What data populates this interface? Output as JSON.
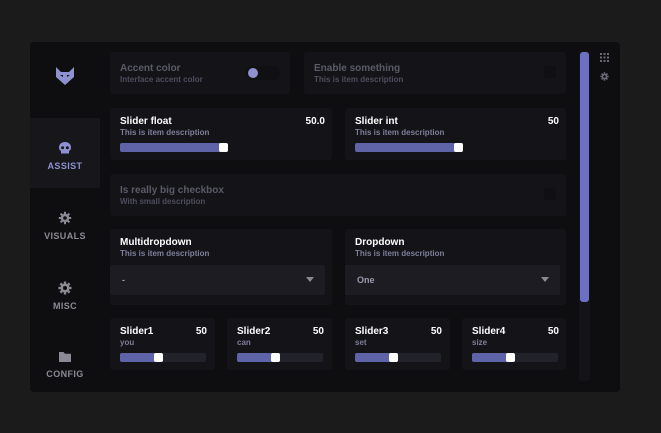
{
  "sidebar": {
    "items": [
      {
        "label": "ASSIST",
        "icon": "skull-icon",
        "active": true
      },
      {
        "label": "VISUALS",
        "icon": "gear-icon",
        "active": false
      },
      {
        "label": "MISC",
        "icon": "gear-icon",
        "active": false
      },
      {
        "label": "CONFIG",
        "icon": "folder-icon",
        "active": false
      }
    ]
  },
  "accent": {
    "title": "Accent color",
    "desc": "Interface accent color",
    "toggle_on": true,
    "color": "#8e90d0"
  },
  "enable": {
    "title": "Enable something",
    "desc": "This is item description"
  },
  "slider_float": {
    "title": "Slider float",
    "desc": "This is item description",
    "value": "50.0",
    "fraction": 1.0
  },
  "slider_int": {
    "title": "Slider int",
    "desc": "This is item description",
    "value": "50",
    "fraction": 1.0
  },
  "big_checkbox": {
    "title": "Is really big checkbox",
    "desc": "With small description"
  },
  "multidropdown": {
    "title": "Multidropdown",
    "desc": "This is item description",
    "selected": "-"
  },
  "dropdown": {
    "title": "Dropdown",
    "desc": "This is item description",
    "selected": "One"
  },
  "small_sliders": [
    {
      "title": "Slider1",
      "desc": "you",
      "value": "50",
      "fraction": 0.5
    },
    {
      "title": "Slider2",
      "desc": "can",
      "value": "50",
      "fraction": 0.5
    },
    {
      "title": "Slider3",
      "desc": "set",
      "value": "50",
      "fraction": 0.5
    },
    {
      "title": "Slider4",
      "desc": "size",
      "value": "50",
      "fraction": 0.5
    }
  ],
  "colors": {
    "background": "#1b1b1c",
    "window": "#0e0e10",
    "card": "#141418",
    "accent": "#6c70c4",
    "slider_fill": "#5f63a8"
  }
}
